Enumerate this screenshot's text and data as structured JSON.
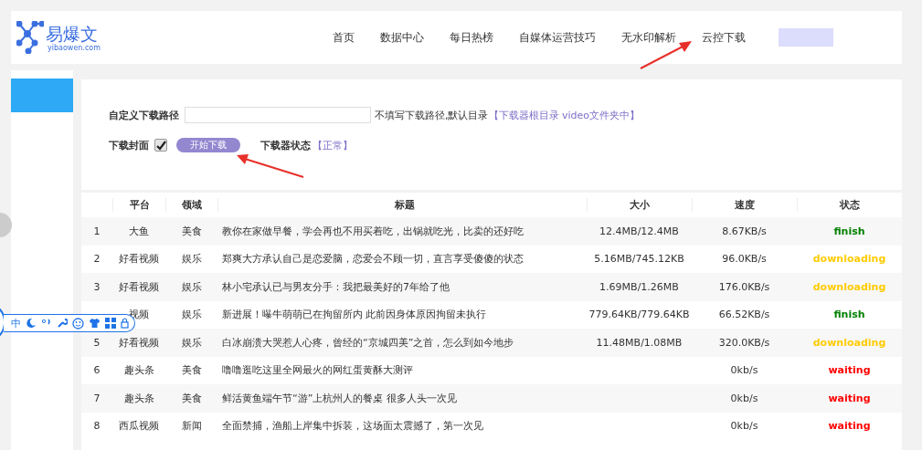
{
  "header": {
    "logo": {
      "name": "易爆文",
      "domain": "yibaowen.com"
    },
    "nav": [
      {
        "label": "首页"
      },
      {
        "label": "数据中心"
      },
      {
        "label": "每日热榜"
      },
      {
        "label": "自媒体运营技巧"
      },
      {
        "label": "无水印解析"
      },
      {
        "label": "云控下载"
      }
    ]
  },
  "form": {
    "path_label": "自定义下载路径",
    "path_hint": "不填写下载路径,默认目录",
    "path_hint_link": "【下载器根目录 video文件夹中】",
    "cover_label": "下载封面",
    "cover_checked": true,
    "start_button": "开始下载",
    "status_label": "下载器状态",
    "status_value": "【正常】"
  },
  "ime_toolbar": {
    "label": "中"
  },
  "table": {
    "columns": [
      "",
      "平台",
      "领域",
      "标题",
      "大小",
      "速度",
      "状态"
    ],
    "rows": [
      {
        "index": "1",
        "platform": "大鱼",
        "field": "美食",
        "title": "教你在家做早餐，学会再也不用买着吃，出锅就吃光，比卖的还好吃",
        "size": "12.4MB/12.4MB",
        "speed": "8.67KB/s",
        "status": "finish",
        "color": "#008000"
      },
      {
        "index": "2",
        "platform": "好看视频",
        "field": "娱乐",
        "title": "郑爽大方承认自己是恋爱脑，恋爱会不顾一切，直言享受傻傻的状态",
        "size": "5.16MB/745.12KB",
        "speed": "96.0KB/s",
        "status": "downloading",
        "color": "#ffcc00"
      },
      {
        "index": "3",
        "platform": "好看视频",
        "field": "娱乐",
        "title": "林小宅承认已与男友分手：我把最美好的7年给了他",
        "size": "1.69MB/1.26MB",
        "speed": "176.0KB/s",
        "status": "downloading",
        "color": "#ffcc00"
      },
      {
        "platform": "视频",
        "field": "娱乐",
        "title": "新进展！曝牛萌萌已在拘留所内 此前因身体原因拘留未执行",
        "size": "779.64KB/779.64KB",
        "speed": "66.52KB/s",
        "status": "finish",
        "color": "#008000"
      },
      {
        "index": "5",
        "platform": "好看视频",
        "field": "娱乐",
        "title": "白冰崩溃大哭惹人心疼，曾经的“京城四美”之首，怎么到如今地步",
        "size": "11.48MB/1.08MB",
        "speed": "320.0KB/s",
        "status": "downloading",
        "color": "#ffcc00"
      },
      {
        "index": "6",
        "platform": "趣头条",
        "field": "美食",
        "title": "噜噜逛吃这里全网最火的网红蛋黄酥大测评",
        "speed": "0kb/s",
        "status": "waiting",
        "color": "#ff0000"
      },
      {
        "index": "7",
        "platform": "趣头条",
        "field": "美食",
        "title": "鲜活黄鱼端午节“游”上杭州人的餐桌 很多人头一次见",
        "speed": "0kb/s",
        "status": "waiting",
        "color": "#ff0000"
      },
      {
        "index": "8",
        "platform": "西瓜视频",
        "field": "新闻",
        "title": "全面禁捕，渔船上岸集中拆装，这场面太震撼了，第一次见",
        "speed": "0kb/s",
        "status": "waiting",
        "color": "#ff0000"
      }
    ]
  }
}
